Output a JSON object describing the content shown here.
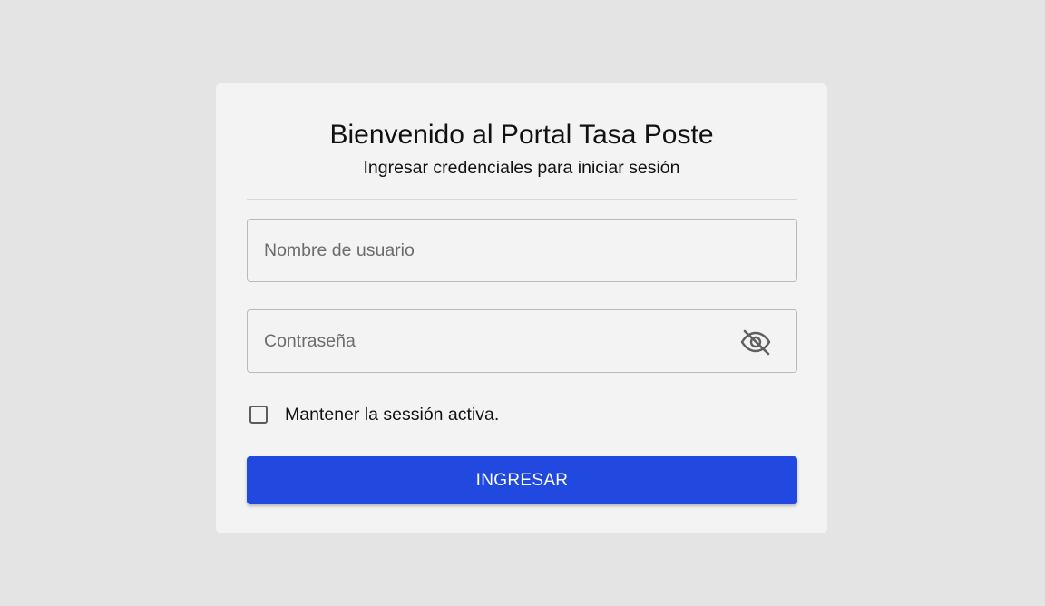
{
  "login": {
    "title": "Bienvenido al Portal Tasa Poste",
    "subtitle": "Ingresar credenciales para iniciar sesión",
    "username": {
      "placeholder": "Nombre de usuario",
      "value": ""
    },
    "password": {
      "placeholder": "Contraseña",
      "value": "",
      "toggle_icon": "eye-off-icon"
    },
    "remember": {
      "label": "Mantener la sessión activa.",
      "checked": false
    },
    "submit_label": "INGRESAR"
  },
  "colors": {
    "background": "#e4e4e4",
    "card": "#f3f3f3",
    "primary": "#2149e0"
  }
}
